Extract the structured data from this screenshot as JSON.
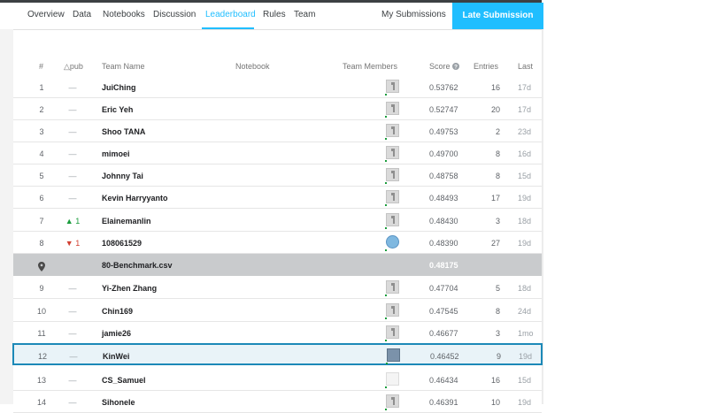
{
  "tabs": [
    {
      "label": "Overview"
    },
    {
      "label": "Data"
    },
    {
      "label": "Notebooks"
    },
    {
      "label": "Discussion"
    },
    {
      "label": "Leaderboard"
    },
    {
      "label": "Rules"
    },
    {
      "label": "Team"
    }
  ],
  "active_tab": "Leaderboard",
  "my_submissions": "My Submissions",
  "late_submission": "Late Submission",
  "columns": {
    "rank": "#",
    "delta": "△pub",
    "team": "Team Name",
    "notebook": "Notebook",
    "members": "Team Members",
    "score": "Score",
    "entries": "Entries",
    "last": "Last"
  },
  "rows": [
    {
      "rank": "1",
      "delta": "—",
      "team": "JuiChing",
      "score": "0.53762",
      "entries": "16",
      "last": "17d",
      "avatar": "default"
    },
    {
      "rank": "2",
      "delta": "—",
      "team": "Eric Yeh",
      "score": "0.52747",
      "entries": "20",
      "last": "17d",
      "avatar": "default"
    },
    {
      "rank": "3",
      "delta": "—",
      "team": "Shoo TANA",
      "score": "0.49753",
      "entries": "2",
      "last": "23d",
      "avatar": "default"
    },
    {
      "rank": "4",
      "delta": "—",
      "team": "mimoei",
      "score": "0.49700",
      "entries": "8",
      "last": "16d",
      "avatar": "default"
    },
    {
      "rank": "5",
      "delta": "—",
      "team": "Johnny Tai",
      "score": "0.48758",
      "entries": "8",
      "last": "15d",
      "avatar": "default"
    },
    {
      "rank": "6",
      "delta": "—",
      "team": "Kevin Harryyanto",
      "score": "0.48493",
      "entries": "17",
      "last": "19d",
      "avatar": "default"
    },
    {
      "rank": "7",
      "delta": "▲ 1",
      "team": "Elainemanlin",
      "score": "0.48430",
      "entries": "3",
      "last": "18d",
      "avatar": "default"
    },
    {
      "rank": "8",
      "delta": "▼ 1",
      "team": "108061529",
      "score": "0.48390",
      "entries": "27",
      "last": "19d",
      "avatar": "globe"
    },
    {
      "benchmark": true,
      "team": "80-Benchmark.csv",
      "score": "0.48175"
    },
    {
      "rank": "9",
      "delta": "—",
      "team": "Yi-Zhen Zhang",
      "score": "0.47704",
      "entries": "5",
      "last": "18d",
      "avatar": "default"
    },
    {
      "rank": "10",
      "delta": "—",
      "team": "Chin169",
      "score": "0.47545",
      "entries": "8",
      "last": "24d",
      "avatar": "default"
    },
    {
      "rank": "11",
      "delta": "—",
      "team": "jamie26",
      "score": "0.46677",
      "entries": "3",
      "last": "1mo",
      "avatar": "default"
    },
    {
      "rank": "12",
      "delta": "—",
      "team": "KinWei",
      "score": "0.46452",
      "entries": "9",
      "last": "19d",
      "avatar": "photo",
      "highlight": true
    },
    {
      "rank": "13",
      "delta": "—",
      "team": "CS_Samuel",
      "score": "0.46434",
      "entries": "16",
      "last": "15d",
      "avatar": "house"
    },
    {
      "rank": "14",
      "delta": "—",
      "team": "Sihonele",
      "score": "0.46391",
      "entries": "10",
      "last": "19d",
      "avatar": "default"
    }
  ]
}
